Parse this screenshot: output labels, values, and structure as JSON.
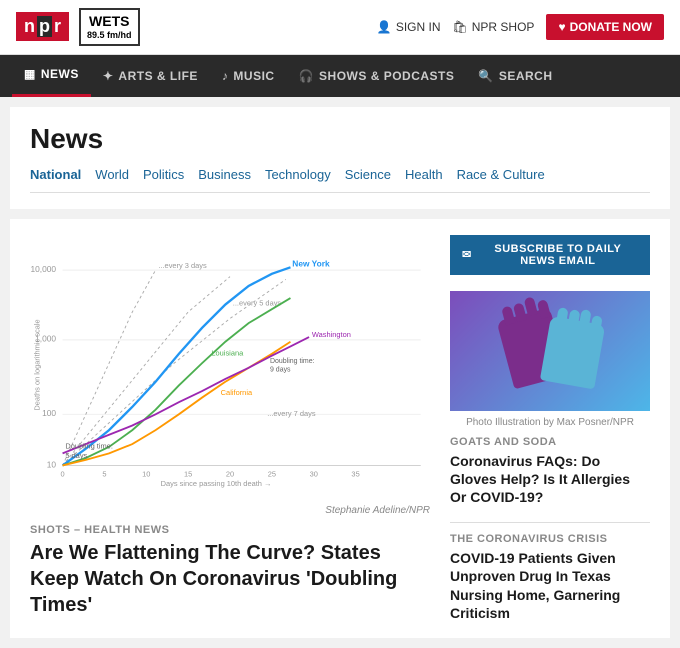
{
  "header": {
    "npr_letters": [
      "n",
      "p",
      "r"
    ],
    "wets_name": "WETS",
    "wets_freq": "89.5 fm/hd",
    "sign_in": "SIGN IN",
    "npr_shop": "NPR SHOP",
    "donate": "DONATE NOW"
  },
  "main_nav": {
    "items": [
      {
        "label": "NEWS",
        "icon": "newspaper"
      },
      {
        "label": "ARTS & LIFE",
        "icon": "music-note"
      },
      {
        "label": "MUSIC",
        "icon": "music"
      },
      {
        "label": "SHOWS & PODCASTS",
        "icon": "headphones"
      },
      {
        "label": "SEARCH",
        "icon": "search"
      }
    ]
  },
  "news_section": {
    "title": "News",
    "subnav": [
      {
        "label": "National",
        "active": true
      },
      {
        "label": "World"
      },
      {
        "label": "Politics"
      },
      {
        "label": "Business"
      },
      {
        "label": "Technology"
      },
      {
        "label": "Science"
      },
      {
        "label": "Health"
      },
      {
        "label": "Race & Culture"
      }
    ]
  },
  "sidebar": {
    "subscribe_btn": "SUBSCRIBE TO DAILY NEWS EMAIL",
    "photo_credit": "Photo Illustration by Max Posner/NPR",
    "article1": {
      "category": "GOATS AND SODA",
      "headline": "Coronavirus FAQs: Do Gloves Help? Is It Allergies Or COVID-19?"
    },
    "article2": {
      "category": "THE CORONAVIRUS CRISIS",
      "headline": "COVID-19 Patients Given Unproven Drug In Texas Nursing Home, Garnering Criticism"
    }
  },
  "main_article": {
    "category": "SHOTS – HEALTH NEWS",
    "headline": "Are We Flattening The Curve? States Keep Watch On Coronavirus 'Doubling Times'",
    "chart_credit": "Stephanie Adeline/NPR"
  }
}
